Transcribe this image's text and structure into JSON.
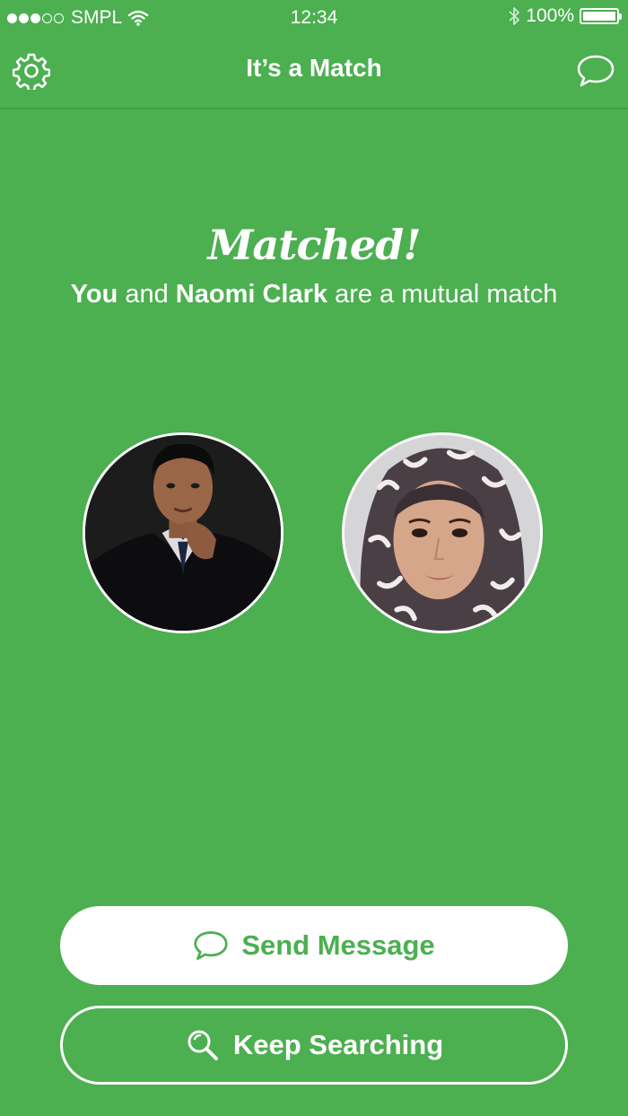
{
  "status_bar": {
    "carrier": "SMPL",
    "time": "12:34",
    "battery": "100%"
  },
  "nav": {
    "title": "It’s a Match",
    "left_icon": "gear-icon",
    "right_icon": "chat-bubble-icon"
  },
  "match": {
    "headline": "Matched!",
    "you": "You",
    "and": " and ",
    "partner_name": "Naomi Clark",
    "suffix": " are a mutual match"
  },
  "actions": {
    "send_label": "Send Message",
    "keep_label": "Keep Searching"
  },
  "colors": {
    "background": "#4caf50",
    "accent": "#4caf50",
    "text": "#ffffff"
  }
}
